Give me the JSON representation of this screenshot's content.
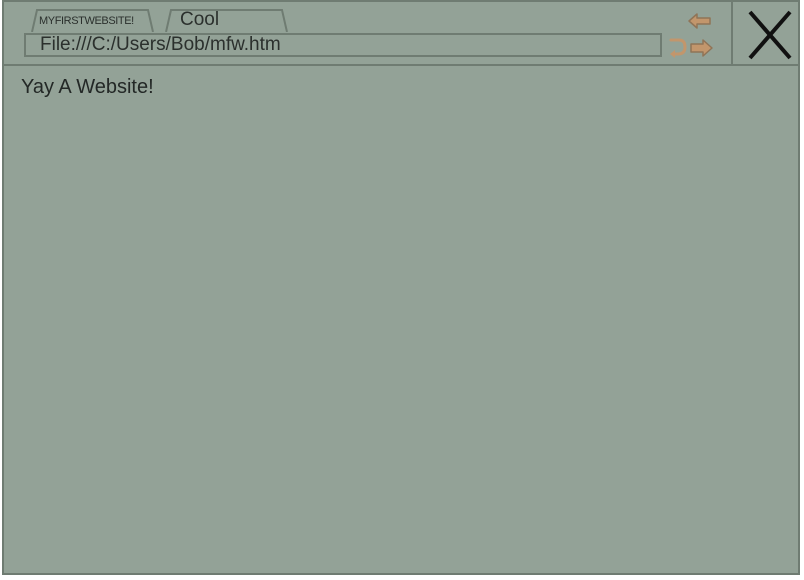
{
  "browser": {
    "tabs": [
      {
        "label": "MYFIRSTWEBSITE!"
      },
      {
        "label": "Cool"
      }
    ],
    "address_bar": {
      "value": "File:///C:/Users/Bob/mfw.htm"
    },
    "nav": {
      "back_icon": "arrow-left-icon",
      "forward_icon": "arrow-right-icon",
      "reload_icon": "reload-icon",
      "close_label": "X"
    }
  },
  "page": {
    "text": "Yay A Website!"
  },
  "colors": {
    "background": "#93a297",
    "border": "#6f7c72",
    "text": "#2b302d",
    "icon_accent": "#c2966c",
    "close": "#111111"
  }
}
